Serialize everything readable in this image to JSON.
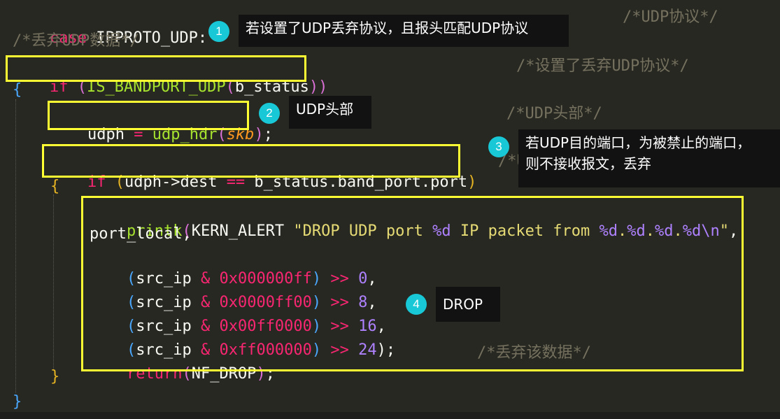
{
  "code": {
    "line0": {
      "keyword": "case",
      "rest": " IPPROTO_UDP:",
      "comment": "/*UDP协议*/"
    },
    "line1": {
      "comment": "/*丢弃UDP数据*/"
    },
    "line2": {
      "keyword": "if",
      "open": " (",
      "fn": "IS_BANDPORT_UDP",
      "p1": "(",
      "arg": "b_status",
      "p2": ")",
      "close": ")",
      "comment": "/*设置了丢弃UDP协议*/"
    },
    "line3": {
      "brace": "{"
    },
    "line4": {
      "var": "udph",
      "op": " = ",
      "fn": "udp_hdr",
      "p1": "(",
      "arg": "skb",
      "p2": ")",
      "semi": ";",
      "comment": "/*UDP头部*/"
    },
    "line5": {
      "keyword": "if",
      "open": " (",
      "expr": "udph->dest ",
      "op": "==",
      "expr2": " b_status.band_port.port",
      "close": ")",
      "comment": "/*UDP端口*/"
    },
    "line6": {
      "brace": "{"
    },
    "line7": {
      "fn": "printk",
      "p": "(",
      "macro": "KERN_ALERT ",
      "str1": "\"DROP UDP port ",
      "f1": "%d",
      "str2": " IP packet from ",
      "f2": "%d",
      "dot1": ".",
      "f3": "%d",
      "dot2": ".",
      "f4": "%d",
      "dot3": ".",
      "f5": "%d",
      "esc": "\\n",
      "str3": "\"",
      "tail": ","
    },
    "line8": {
      "text": "port_local,"
    },
    "line9": {
      "open": "(",
      "var": "src_ip ",
      "amp": "&",
      "num_prefix": " 0x",
      "hex": "000000ff",
      "close": ")",
      "shift": " >> ",
      "n": "0",
      "tail": ","
    },
    "line10": {
      "open": "(",
      "var": "src_ip ",
      "amp": "&",
      "num_prefix": " 0x",
      "hex": "0000ff00",
      "close": ")",
      "shift": " >> ",
      "n": "8",
      "tail": ","
    },
    "line11": {
      "open": "(",
      "var": "src_ip ",
      "amp": "&",
      "num_prefix": " 0x",
      "hex": "00ff0000",
      "close": ")",
      "shift": " >> ",
      "n": "16",
      "tail": ","
    },
    "line12": {
      "open": "(",
      "var": "src_ip ",
      "amp": "&",
      "num_prefix": " 0x",
      "hex": "ff000000",
      "close": ")",
      "shift": " >> ",
      "n": "24",
      "tail": ");"
    },
    "line13": {
      "keyword": "return",
      "p1": "(",
      "arg": "NF_DROP",
      "p2": ")",
      "semi": ";",
      "comment": "/*丢弃该数据*/"
    },
    "line14": {
      "brace": "}"
    },
    "line15": {
      "brace": "}"
    }
  },
  "callouts": [
    {
      "num": "1",
      "text": "若设置了UDP丢弃协议，且报头匹配UDP协议"
    },
    {
      "num": "2",
      "text": "UDP头部"
    },
    {
      "num": "3",
      "line1": "若UDP目的端口，为被禁止的端口，",
      "line2": "则不接收报文，丢弃"
    },
    {
      "num": "4",
      "text": "DROP"
    }
  ],
  "colors": {
    "background": "#272822",
    "keyword": "#f92672",
    "function": "#a6e22e",
    "comment": "#75715e",
    "string": "#e6db74",
    "number": "#ae81ff",
    "highlight_box": "#ffff33",
    "callout_badge": "#19c8d6",
    "callout_bg": "#121212"
  }
}
